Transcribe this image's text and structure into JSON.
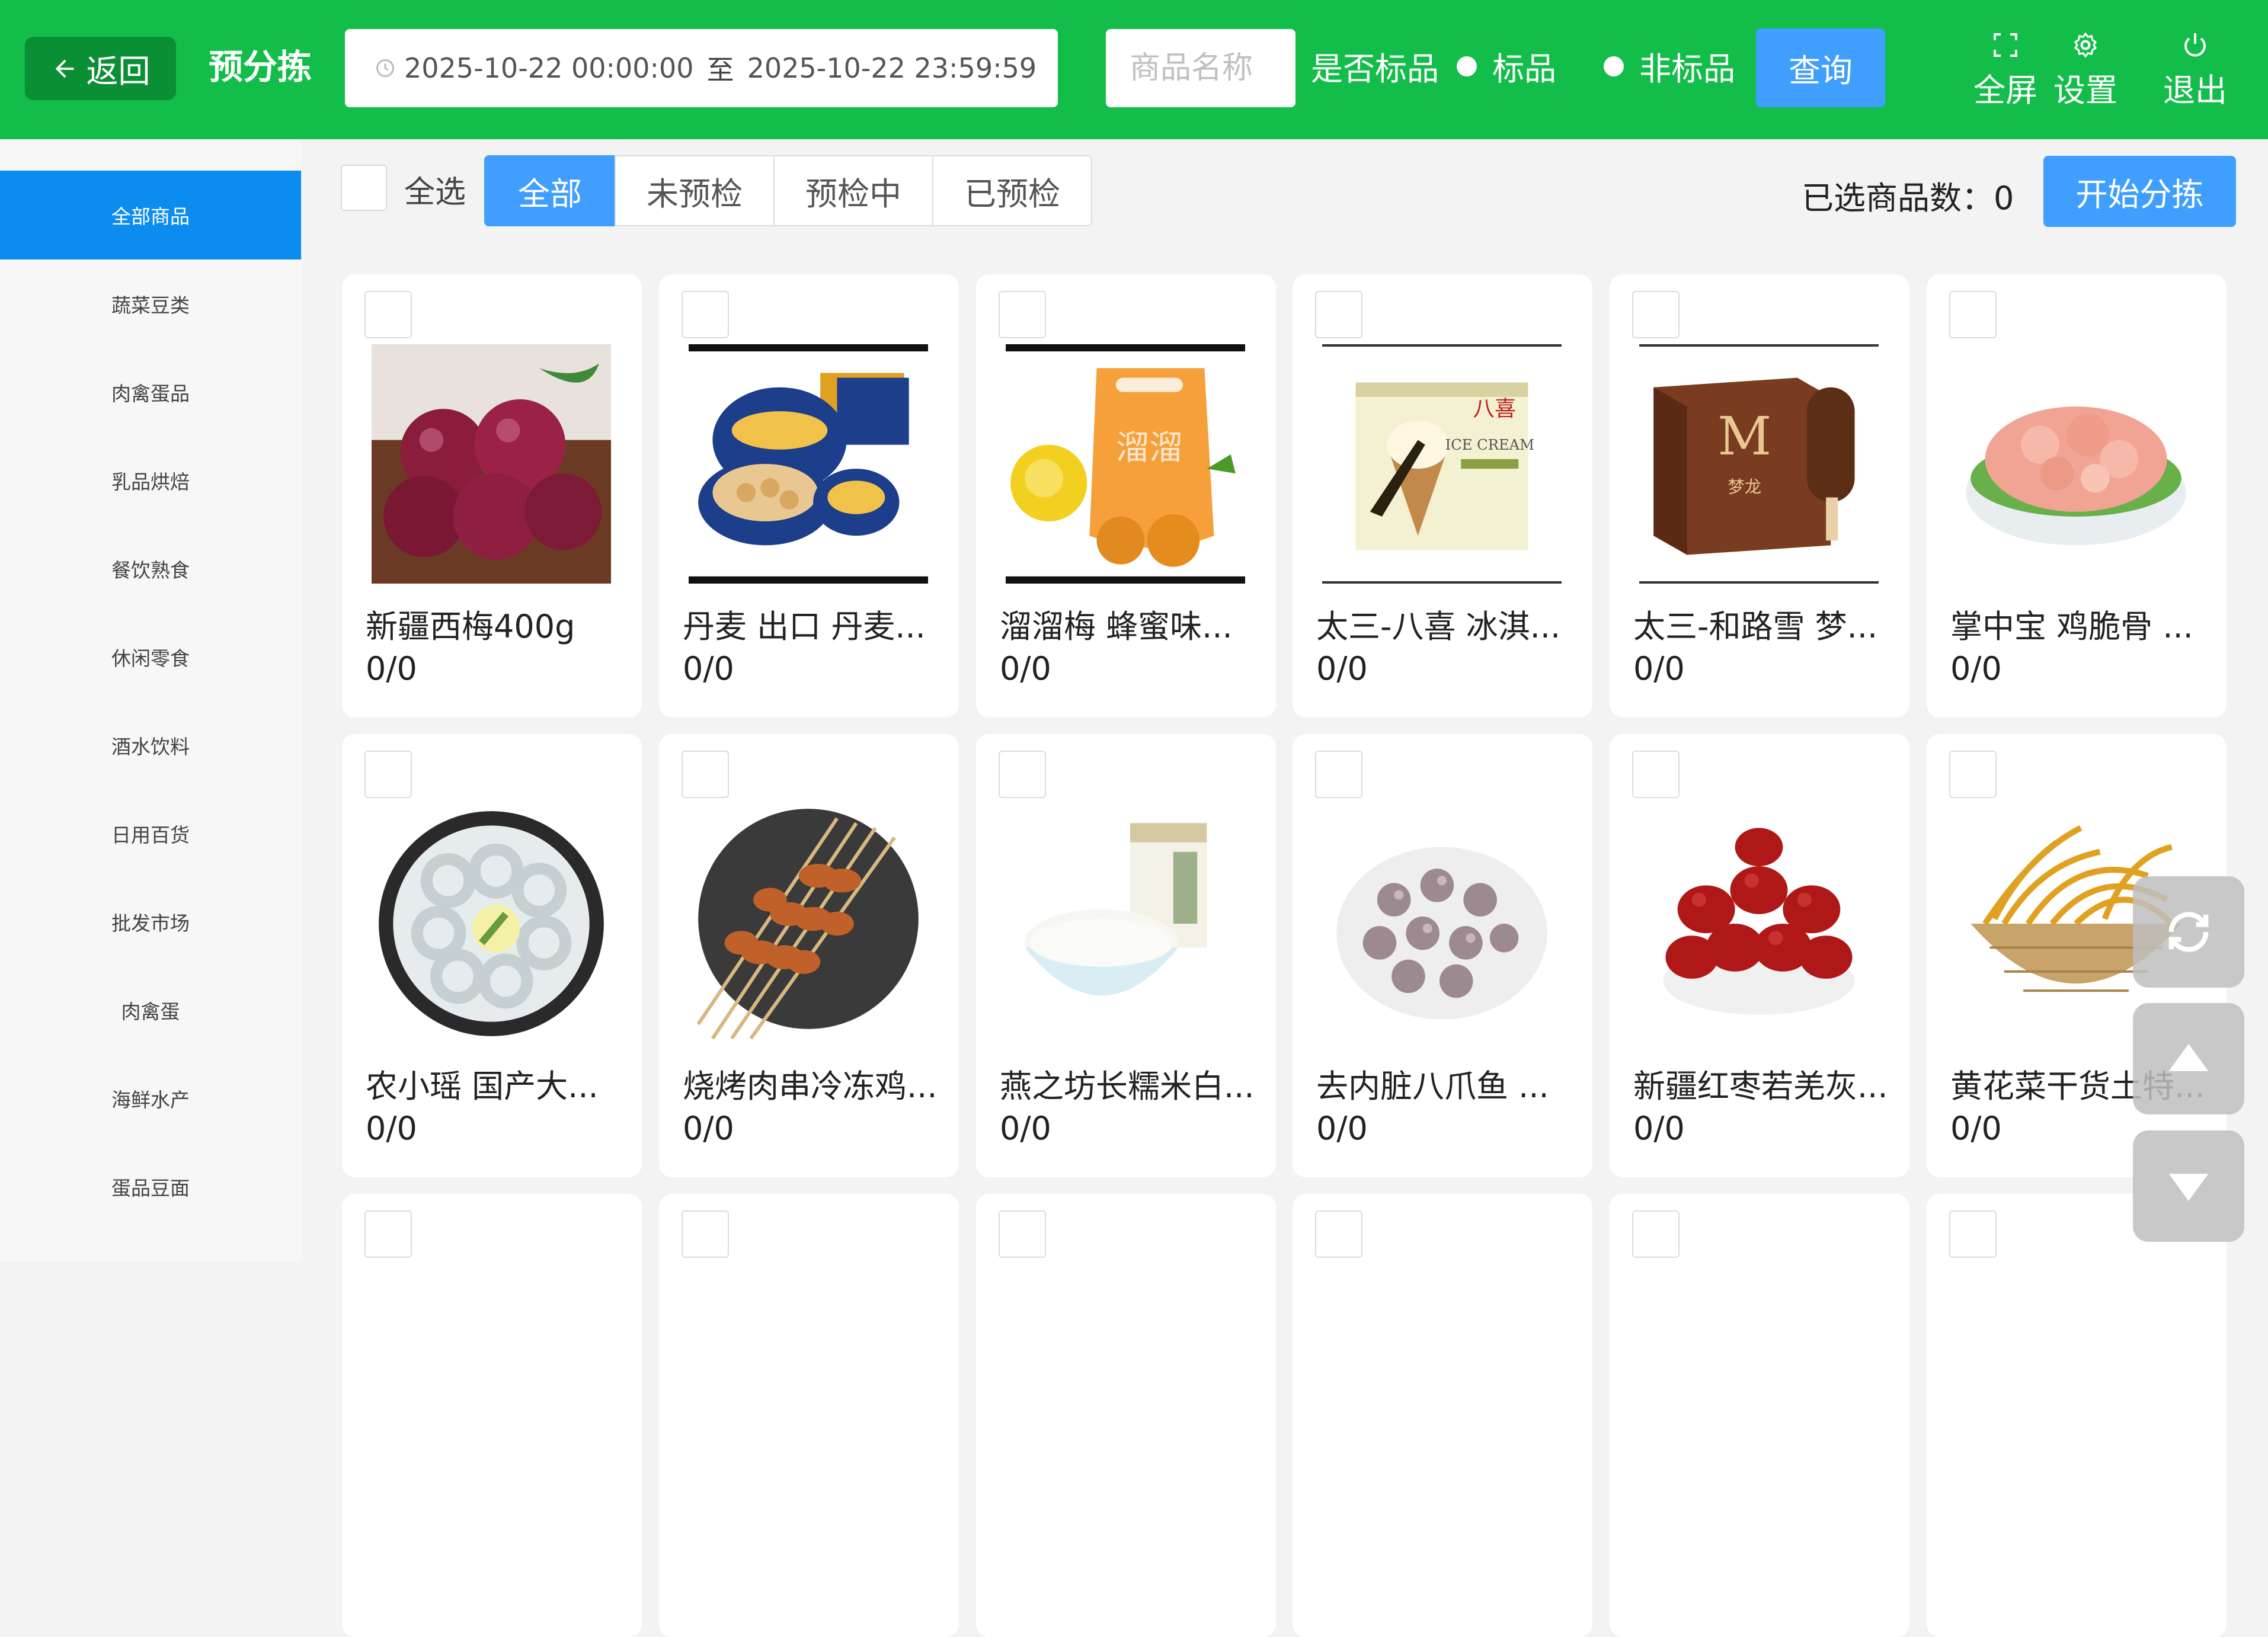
{
  "header": {
    "back_label": "返回",
    "title": "预分拣",
    "date_start": "2025-10-22 00:00:00",
    "date_separator": "至",
    "date_end": "2025-10-22 23:59:59",
    "name_placeholder": "商品名称",
    "standard_label": "是否标品",
    "radio_standard": "标品",
    "radio_nonstandard": "非标品",
    "query_label": "查询",
    "fullscreen_label": "全屏",
    "settings_label": "设置",
    "logout_label": "退出",
    "brand_color": "#12bd49"
  },
  "sidebar": {
    "items": [
      {
        "label": "全部商品",
        "active": true
      },
      {
        "label": "蔬菜豆类"
      },
      {
        "label": "肉禽蛋品"
      },
      {
        "label": "乳品烘焙"
      },
      {
        "label": "餐饮熟食"
      },
      {
        "label": "休闲零食"
      },
      {
        "label": "酒水饮料"
      },
      {
        "label": "日用百货"
      },
      {
        "label": "批发市场"
      },
      {
        "label": "肉禽蛋"
      },
      {
        "label": "海鲜水产"
      },
      {
        "label": "蛋品豆面"
      }
    ]
  },
  "filters": {
    "select_all": "全选",
    "tabs": [
      "全部",
      "未预检",
      "预检中",
      "已预检"
    ],
    "active_tab": "全部",
    "selected_count_label": "已选商品数：0",
    "start_label": "开始分拣",
    "accent_color": "#409eff"
  },
  "products": [
    {
      "name": "新疆西梅400g",
      "qty": "0/0",
      "icon": "plums-image"
    },
    {
      "name": "丹麦 出口 丹麦...",
      "qty": "0/0",
      "icon": "butter-cookies-image"
    },
    {
      "name": "溜溜梅 蜂蜜味...",
      "qty": "0/0",
      "icon": "dried-plum-pack-image"
    },
    {
      "name": "太三-八喜 冰淇...",
      "qty": "0/0",
      "icon": "ice-cream-box-image"
    },
    {
      "name": "太三-和路雪 梦...",
      "qty": "0/0",
      "icon": "magnum-box-image"
    },
    {
      "name": "掌中宝 鸡脆骨 ...",
      "qty": "0/0",
      "icon": "chicken-cartilage-image"
    },
    {
      "name": "农小瑶 国产大...",
      "qty": "0/0",
      "icon": "shrimp-plate-image"
    },
    {
      "name": "烧烤肉串冷冻鸡...",
      "qty": "0/0",
      "icon": "meat-skewers-image"
    },
    {
      "name": "燕之坊长糯米白...",
      "qty": "0/0",
      "icon": "rice-bowl-image"
    },
    {
      "name": "去内脏八爪鱼 ...",
      "qty": "0/0",
      "icon": "octopus-plate-image"
    },
    {
      "name": "新疆红枣若羌灰...",
      "qty": "0/0",
      "icon": "red-dates-image"
    },
    {
      "name": "黄花菜干货土特...",
      "qty": "0/0",
      "icon": "daylily-basket-image"
    }
  ]
}
